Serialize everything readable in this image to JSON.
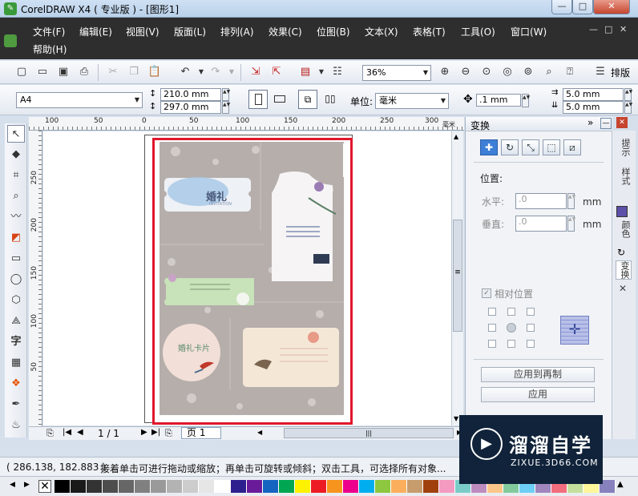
{
  "window": {
    "title": "CorelDRAW X4 ( 专业版 ) - [图形1]",
    "controls": [
      "—",
      "□",
      "✕"
    ]
  },
  "menu": {
    "items": [
      "文件(F)",
      "编辑(E)",
      "视图(V)",
      "版面(L)",
      "排列(A)",
      "效果(C)",
      "位图(B)",
      "文本(X)",
      "表格(T)",
      "工具(O)",
      "窗口(W)"
    ],
    "help": "帮助(H)",
    "doc_controls": [
      "—",
      "□",
      "✕"
    ]
  },
  "toolbar1": {
    "icons": [
      "new-icon",
      "open-icon",
      "save-icon",
      "print-icon",
      "cut-icon",
      "copy-icon",
      "paste-icon",
      "undo-icon",
      "redo-icon",
      "import-icon",
      "export-icon",
      "app-launcher-icon",
      "welcome-icon"
    ],
    "zoom": "36%",
    "zoom_icons": [
      "zoom-in-icon",
      "zoom-out-icon",
      "zoom-selected-icon",
      "zoom-all-icon",
      "zoom-page-icon",
      "zoom-width-icon",
      "zoom-height-icon"
    ],
    "snap_label": "排版"
  },
  "propbar": {
    "paper": "A4",
    "width": "210.0 mm",
    "height": "297.0 mm",
    "units_label": "单位:",
    "units": "毫米",
    "nudge": ".1 mm",
    "dup_x": "5.0 mm",
    "dup_y": "5.0 mm"
  },
  "ruler_top": [
    "100",
    "50",
    "0",
    "50",
    "100",
    "150",
    "200",
    "250",
    "300",
    "毫米"
  ],
  "ruler_left": [
    "250",
    "200",
    "150",
    "100",
    "50"
  ],
  "artwork": {
    "card1_title": "婚礼",
    "card1_sub": "INVITATION",
    "card4_title": "婚礼卡片"
  },
  "pagenav": {
    "counter": "1 / 1",
    "page_tab": "页 1"
  },
  "docker": {
    "title": "变换",
    "position_label": "位置:",
    "h_label": "水平:",
    "v_label": "垂直:",
    "h_value": ".0",
    "v_value": ".0",
    "unit": "mm",
    "relative_label": "相对位置",
    "relative_checked": true,
    "apply_dup": "应用到再制",
    "apply": "应用"
  },
  "sidetabs": [
    "提示",
    "样式",
    "颜色",
    "变换"
  ],
  "status": {
    "coords": "( 286.138, 182.883 )",
    "hint": "接着单击可进行拖动或缩放；再单击可旋转或倾斜；双击工具，可选择所有对象..."
  },
  "palette": {
    "colors": [
      "#000000",
      "#1a1a1a",
      "#333333",
      "#4d4d4d",
      "#666666",
      "#808080",
      "#999999",
      "#b3b3b3",
      "#cccccc",
      "#e6e6e6",
      "#ffffff",
      "#2e1f8f",
      "#6a1b9a",
      "#1565c0",
      "#00a651",
      "#fff200",
      "#ed1c24",
      "#f7941d",
      "#ec008c",
      "#00aeef",
      "#8dc63f",
      "#fbaf5d",
      "#c69c6d",
      "#a0410d",
      "#f49ac1",
      "#7accc8",
      "#bd8cbf",
      "#fdc689",
      "#82ca9c",
      "#6dcff6",
      "#a186be",
      "#f26d7d",
      "#c4df9b",
      "#fff799",
      "#8781bd"
    ]
  },
  "watermark": {
    "brand": "溜溜自学",
    "url": "ZIXUE.3D66.COM"
  }
}
